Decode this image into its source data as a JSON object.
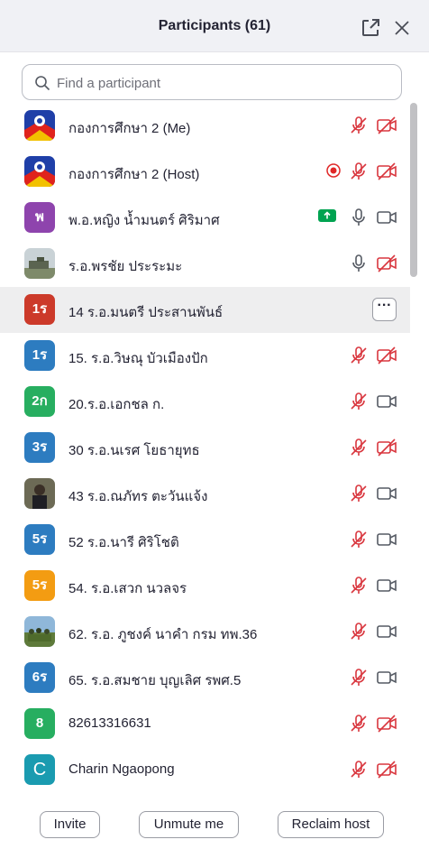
{
  "header": {
    "title": "Participants (61)"
  },
  "search": {
    "placeholder": "Find a participant"
  },
  "participants": [
    {
      "name": "กองการศึกษา 2 (Me)",
      "avatar": {
        "type": "image",
        "desc": "emblem"
      },
      "recording": false,
      "mic": "muted",
      "video": "off"
    },
    {
      "name": "กองการศึกษา 2 (Host)",
      "avatar": {
        "type": "image",
        "desc": "emblem"
      },
      "recording": true,
      "mic": "muted",
      "video": "off"
    },
    {
      "name": "พ.อ.หญิง น้ำมนตร์ ศิริมาศ",
      "avatar": {
        "type": "initials",
        "text": "พ",
        "color": "#8e44ad"
      },
      "sharing": true,
      "mic": "on",
      "video": "on"
    },
    {
      "name": "ร.อ.พรชัย ประระมะ",
      "avatar": {
        "type": "image",
        "desc": "photo"
      },
      "mic": "on",
      "video": "off"
    },
    {
      "name": "14 ร.อ.มนตรี ประสานพันธ์",
      "avatar": {
        "type": "initials",
        "text": "1ร",
        "color": "#cc3a2a"
      },
      "hovered": true,
      "more_label": "···"
    },
    {
      "name": "15. ร.อ.วิษณุ บัวเมืองปัก",
      "avatar": {
        "type": "initials",
        "text": "1ร",
        "color": "#2d7cc0"
      },
      "mic": "muted",
      "video": "off"
    },
    {
      "name": "20.ร.อ.เอกชล ก.",
      "avatar": {
        "type": "initials",
        "text": "2ก",
        "color": "#27ae60"
      },
      "mic": "muted",
      "video": "on"
    },
    {
      "name": "30 ร.อ.นเรศ โยธายุทธ",
      "avatar": {
        "type": "initials",
        "text": "3ร",
        "color": "#2d7cc0"
      },
      "mic": "muted",
      "video": "off"
    },
    {
      "name": "43 ร.อ.ณภัทร ตะวันแจ้ง",
      "avatar": {
        "type": "image",
        "desc": "photo"
      },
      "mic": "muted",
      "video": "on"
    },
    {
      "name": "52 ร.อ.นารี ศิริโชติ",
      "avatar": {
        "type": "initials",
        "text": "5ร",
        "color": "#2d7cc0"
      },
      "mic": "muted",
      "video": "on"
    },
    {
      "name": "54. ร.อ.เสวก นวลจร",
      "avatar": {
        "type": "initials",
        "text": "5ร",
        "color": "#f39c12"
      },
      "mic": "muted",
      "video": "on"
    },
    {
      "name": "62. ร.อ. ภูชงค์ นาคำ กรม ทพ.36",
      "avatar": {
        "type": "image",
        "desc": "group photo"
      },
      "mic": "muted",
      "video": "on"
    },
    {
      "name": "65. ร.อ.สมชาย บุญเลิศ รพศ.5",
      "avatar": {
        "type": "initials",
        "text": "6ร",
        "color": "#2d7cc0"
      },
      "mic": "muted",
      "video": "on"
    },
    {
      "name": "82613316631",
      "avatar": {
        "type": "initials",
        "text": "8",
        "color": "#27ae60"
      },
      "mic": "muted",
      "video": "off"
    },
    {
      "name": "Charin Ngaopong",
      "avatar": {
        "type": "initials",
        "text": "C",
        "color": "#1a9bb0",
        "big": true
      },
      "mic": "muted",
      "video": "off"
    }
  ],
  "footer": {
    "invite": "Invite",
    "unmute": "Unmute me",
    "reclaim": "Reclaim host"
  },
  "colors": {
    "muted_red": "#d9363e",
    "icon_gray": "#555a63",
    "share_green": "#00a351",
    "record_red": "#e02828"
  },
  "icons": {
    "popout": "popout-icon",
    "close": "close-icon",
    "search": "search-icon",
    "mic_off": "mic-muted-icon",
    "mic_on": "mic-icon",
    "video_off": "video-off-icon",
    "video_on": "video-icon",
    "recording": "recording-icon",
    "share": "share-screen-icon"
  }
}
